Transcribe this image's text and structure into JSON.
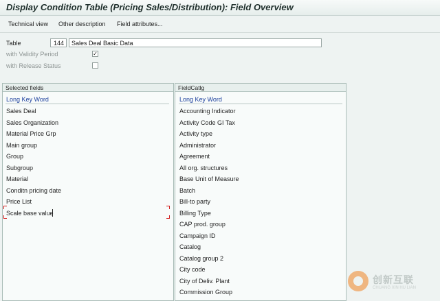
{
  "window": {
    "title": "Display Condition Table (Pricing Sales/Distribution): Field Overview"
  },
  "toolbar": {
    "buttons": [
      "Technical view",
      "Other description",
      "Field attributes..."
    ]
  },
  "form": {
    "table_label": "Table",
    "table_number": "144",
    "table_desc": "Sales Deal Basic Data",
    "validity_label": "with Validity Period",
    "validity_checked": true,
    "validity_mark": "✓",
    "release_label": "with Release Status",
    "release_checked": false
  },
  "selected": {
    "header": "Selected fields",
    "column_head": "Long Key Word",
    "rows": [
      "Sales Deal",
      "Sales Organization",
      "Material Price Grp",
      "Main group",
      "Group",
      "Subgroup",
      "Material",
      "Conditn pricing date",
      "Price List",
      "Scale base value"
    ]
  },
  "catalog": {
    "header": "FieldCatlg",
    "column_head": "Long Key Word",
    "rows": [
      "Accounting Indicator",
      "Activity Code GI Tax",
      "Activity type",
      "Administrator",
      "Agreement",
      "All org. structures",
      "Base Unit of Measure",
      "Batch",
      "Bill-to party",
      "Billing Type",
      "CAP prod. group",
      "Campaign ID",
      "Catalog",
      "Catalog group 2",
      "City code",
      "City of Deliv. Plant",
      "Commission Group"
    ]
  },
  "watermark": {
    "name": "创新互联",
    "sub": "CHUANG XIN HU LIAN"
  },
  "colors": {
    "background": "#eef3f2",
    "column_head": "#1b3f9c",
    "focus_marker": "#d21e1e"
  }
}
